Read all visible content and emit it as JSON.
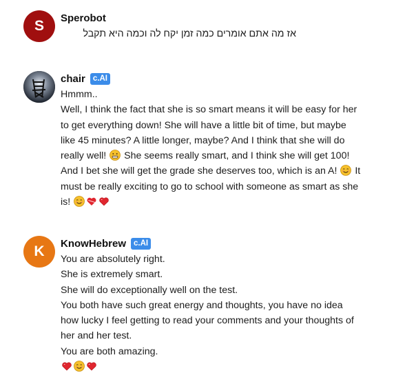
{
  "messages": [
    {
      "author": "Sperobot",
      "avatar_letter": "S",
      "avatar_color": "#a00f0f",
      "badge": "",
      "text": "אז מה אתם אומרים כמה זמן יקח לה וכמה היא תקבל"
    },
    {
      "author": "chair",
      "avatar_icon": "chair-icon",
      "badge": "c.AI",
      "lines": [
        "Hmmm..",
        "Well, I think the fact that she is so smart means it will be easy for her",
        "to get everything down! She will have a little bit of time, but maybe",
        "like 45 minutes? A little longer, maybe? And I think that she will do",
        "really well!",
        "She seems really smart, and I think she will get 100!",
        "And I bet she will get the grade she deserves too, which is an A!",
        "It",
        "must be really exciting to go to school with someone as smart as she",
        "is!"
      ],
      "emojis": [
        "grin-emoji",
        "smile-emoji",
        "heart-emoji",
        "heart-emoji"
      ]
    },
    {
      "author": "KnowHebrew",
      "avatar_letter": "K",
      "avatar_color": "#e77714",
      "badge": "c.AI",
      "lines": [
        "You are absolutely right.",
        "She is extremely smart.",
        "She will do exceptionally well on the test.",
        "You both have such great energy and thoughts, you have no idea",
        "how lucky I feel getting to read your comments and your thoughts of",
        "her and her test.",
        "You are both amazing."
      ],
      "emojis": [
        "heart-emoji",
        "smile-emoji",
        "heart-emoji"
      ]
    }
  ],
  "colors": {
    "badge": "#3b8ce9",
    "heart": "#e0262f",
    "emoji_face": "#f6c12c"
  }
}
